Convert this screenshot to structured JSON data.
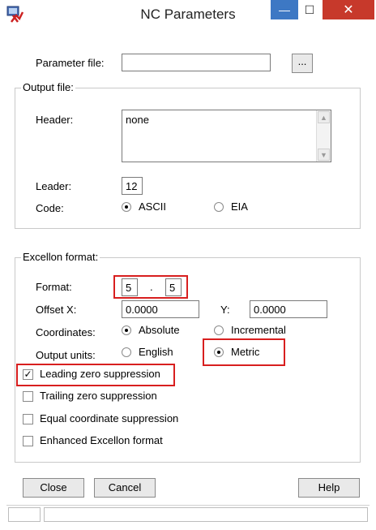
{
  "window": {
    "title": "NC Parameters"
  },
  "titlebar": {
    "min_glyph": "—",
    "max_glyph": "☐",
    "close_glyph": "✕"
  },
  "parameter_file": {
    "label": "Parameter file:",
    "value": "",
    "browse_label": "..."
  },
  "output_file": {
    "group_label": "Output file:",
    "header_label": "Header:",
    "header_value": "none",
    "leader_label": "Leader:",
    "leader_value": "12",
    "code_label": "Code:",
    "code_options": [
      "ASCII",
      "EIA"
    ],
    "code_selected": "ASCII"
  },
  "excellon": {
    "group_label": "Excellon format:",
    "format_label": "Format:",
    "format_int": "5",
    "format_sep": ".",
    "format_dec": "5",
    "offset_x_label": "Offset X:",
    "offset_x_value": "0.0000",
    "offset_y_label": "Y:",
    "offset_y_value": "0.0000",
    "coordinates_label": "Coordinates:",
    "coordinates_options": [
      "Absolute",
      "Incremental"
    ],
    "coordinates_selected": "Absolute",
    "units_label": "Output units:",
    "units_options": [
      "English",
      "Metric"
    ],
    "units_selected": "Metric"
  },
  "checkboxes": [
    {
      "label": "Leading zero suppression",
      "checked": true
    },
    {
      "label": "Trailing zero suppression",
      "checked": false
    },
    {
      "label": "Equal coordinate suppression",
      "checked": false
    },
    {
      "label": "Enhanced Excellon format",
      "checked": false
    }
  ],
  "buttons": {
    "close": "Close",
    "cancel": "Cancel",
    "help": "Help"
  },
  "colors": {
    "highlight_box": "#d81f1f",
    "minimize_bg": "#3d78c4",
    "close_bg": "#c7392b"
  }
}
